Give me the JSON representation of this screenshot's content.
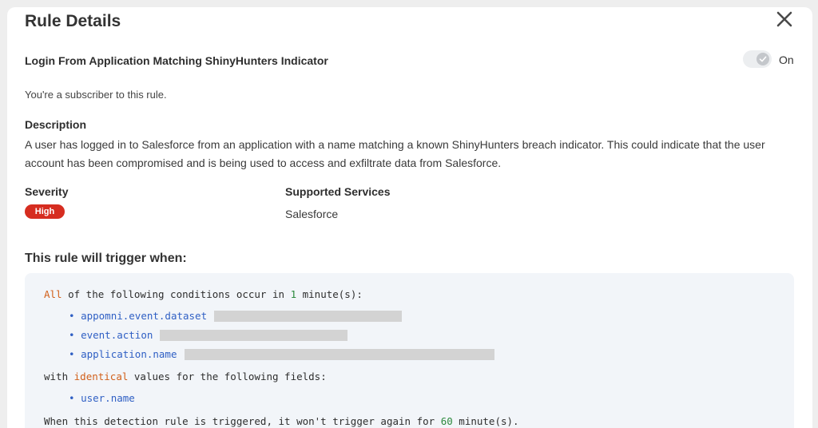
{
  "dialog": {
    "title": "Rule Details",
    "rule_name": "Login From Application Matching ShinyHunters Indicator",
    "toggle": {
      "state_label": "On",
      "enabled": true
    },
    "subscriber_text": "You're a subscriber to this rule.",
    "description_heading": "Description",
    "description_text": "A user has logged in to Salesforce from an application with a name matching a known ShinyHunters breach indicator. This could indicate that the user account has been compromised and is being used to access and exfiltrate data from Salesforce.",
    "severity_heading": "Severity",
    "severity_value": "High",
    "services_heading": "Supported Services",
    "services_value": "Salesforce",
    "trigger_heading": "This rule will trigger when:"
  },
  "trigger": {
    "quantifier": "All",
    "conditions_prefix": " of the following conditions occur in ",
    "window_value": "1",
    "conditions_suffix": " minute(s):",
    "conditions": [
      {
        "bullet": "•",
        "field": "appomni.event.dataset"
      },
      {
        "bullet": "•",
        "field": "event.action"
      },
      {
        "bullet": "•",
        "field": "application.name"
      }
    ],
    "grouping_prefix": "with ",
    "grouping_keyword": "identical",
    "grouping_suffix": " values for the following fields:",
    "group_fields": [
      {
        "bullet": "•",
        "field": "user.name"
      }
    ],
    "cooldown_prefix": "When this detection rule is triggered, it won't trigger again for ",
    "cooldown_value": "60",
    "cooldown_suffix": " minute(s)."
  },
  "colors": {
    "severity_high": "#d62d20",
    "keyword_orange": "#d2601a",
    "number_green": "#2d8a3e",
    "field_blue": "#2f5fc4",
    "code_background": "#f2f5f9"
  },
  "icons": {
    "close": "close-icon",
    "toggle_check": "check-icon"
  }
}
